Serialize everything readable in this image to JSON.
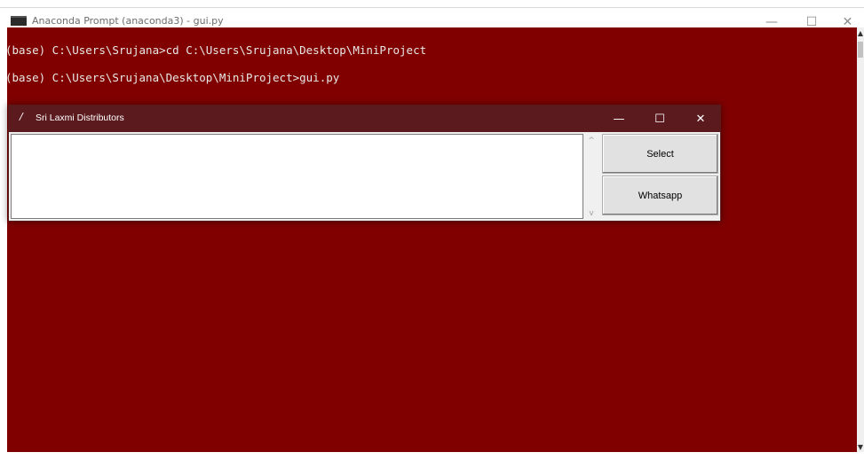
{
  "outer_window": {
    "title": "Anaconda Prompt (anaconda3) - gui.py",
    "minimize": "—",
    "maximize": "☐",
    "close": "✕"
  },
  "console": {
    "lines": [
      "(base) C:\\Users\\Srujana>cd C:\\Users\\Srujana\\Desktop\\MiniProject",
      "(base) C:\\Users\\Srujana\\Desktop\\MiniProject>gui.py"
    ],
    "background_color": "#800000"
  },
  "app_window": {
    "title": "Sri Laxmi Distributors",
    "minimize": "—",
    "maximize": "☐",
    "close": "✕",
    "titlebar_color": "#5b1a1e",
    "buttons": {
      "select": "Select",
      "whatsapp": "Whatsapp"
    }
  }
}
